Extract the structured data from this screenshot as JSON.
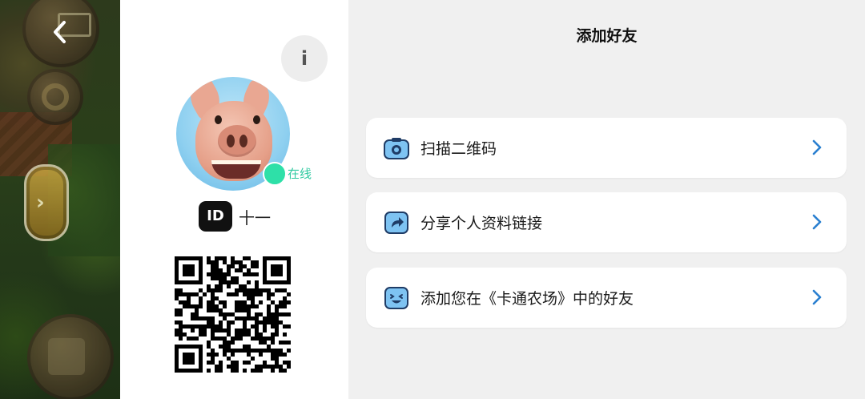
{
  "window": {
    "title": "添加好友"
  },
  "profile": {
    "status_label": "在线",
    "id_badge": "ID",
    "display_name": "十一",
    "info_icon": "i"
  },
  "options": [
    {
      "label": "扫描二维码",
      "icon": "camera-icon"
    },
    {
      "label": "分享个人资料链接",
      "icon": "share-icon"
    },
    {
      "label": "添加您在《卡通农场》中的好友",
      "icon": "smiley-icon"
    }
  ],
  "colors": {
    "accent": "#2a7fd0",
    "online": "#2ee0a8",
    "panel_bg": "#f0f0f0",
    "card_bg": "#ffffff",
    "icon_fill": "#7ec3f2"
  }
}
